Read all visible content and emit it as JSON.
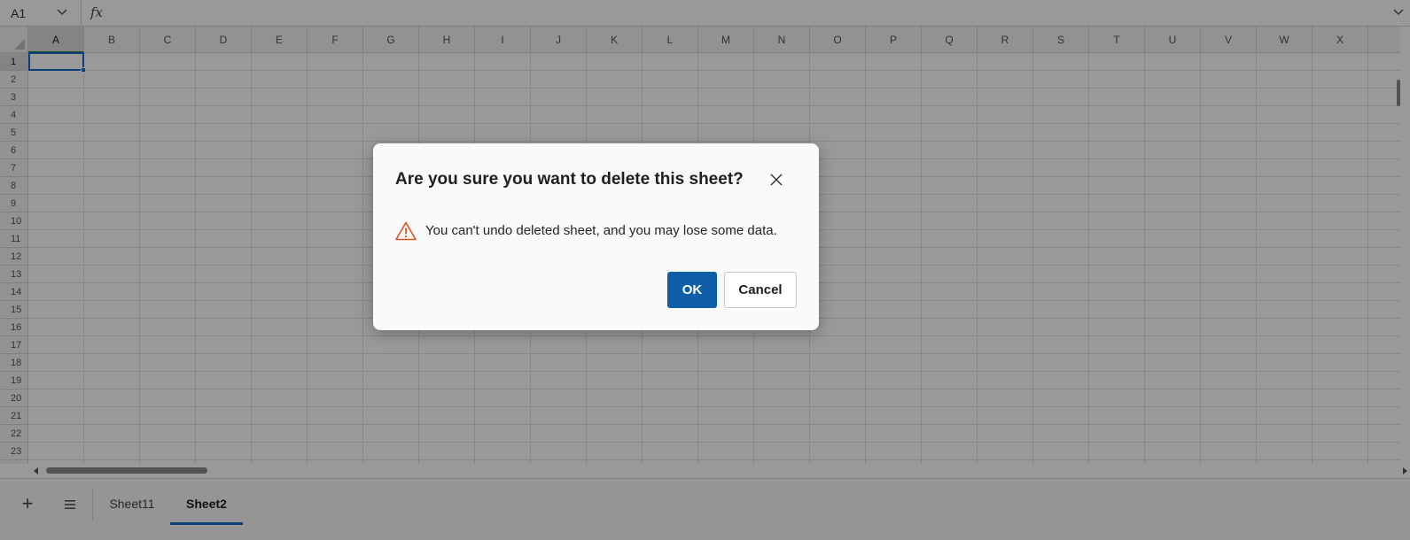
{
  "formula_bar": {
    "name_box": "A1",
    "fx_label": "fx"
  },
  "grid": {
    "columns": [
      "A",
      "B",
      "C",
      "D",
      "E",
      "F",
      "G",
      "H",
      "I",
      "J",
      "K",
      "L",
      "M",
      "N",
      "O",
      "P",
      "Q",
      "R",
      "S",
      "T",
      "U",
      "V",
      "W",
      "X"
    ],
    "rows": [
      "1",
      "2",
      "3",
      "4",
      "5",
      "6",
      "7",
      "8",
      "9",
      "10",
      "11",
      "12",
      "13",
      "14",
      "15",
      "16",
      "17",
      "18",
      "19",
      "20",
      "21",
      "22",
      "23"
    ],
    "active_cell": "A1"
  },
  "sheet_tabs": {
    "add_label": "+",
    "tabs": [
      {
        "label": "Sheet11",
        "active": false
      },
      {
        "label": "Sheet2",
        "active": true
      }
    ]
  },
  "dialog": {
    "title": "Are you sure you want to delete this sheet?",
    "message": "You can't undo deleted sheet, and you may lose some data.",
    "ok_label": "OK",
    "cancel_label": "Cancel",
    "icons": {
      "close": "close-icon",
      "warning": "warning-icon"
    },
    "colors": {
      "ok_button": "#0f5fa8",
      "warning": "#d9531e"
    }
  }
}
